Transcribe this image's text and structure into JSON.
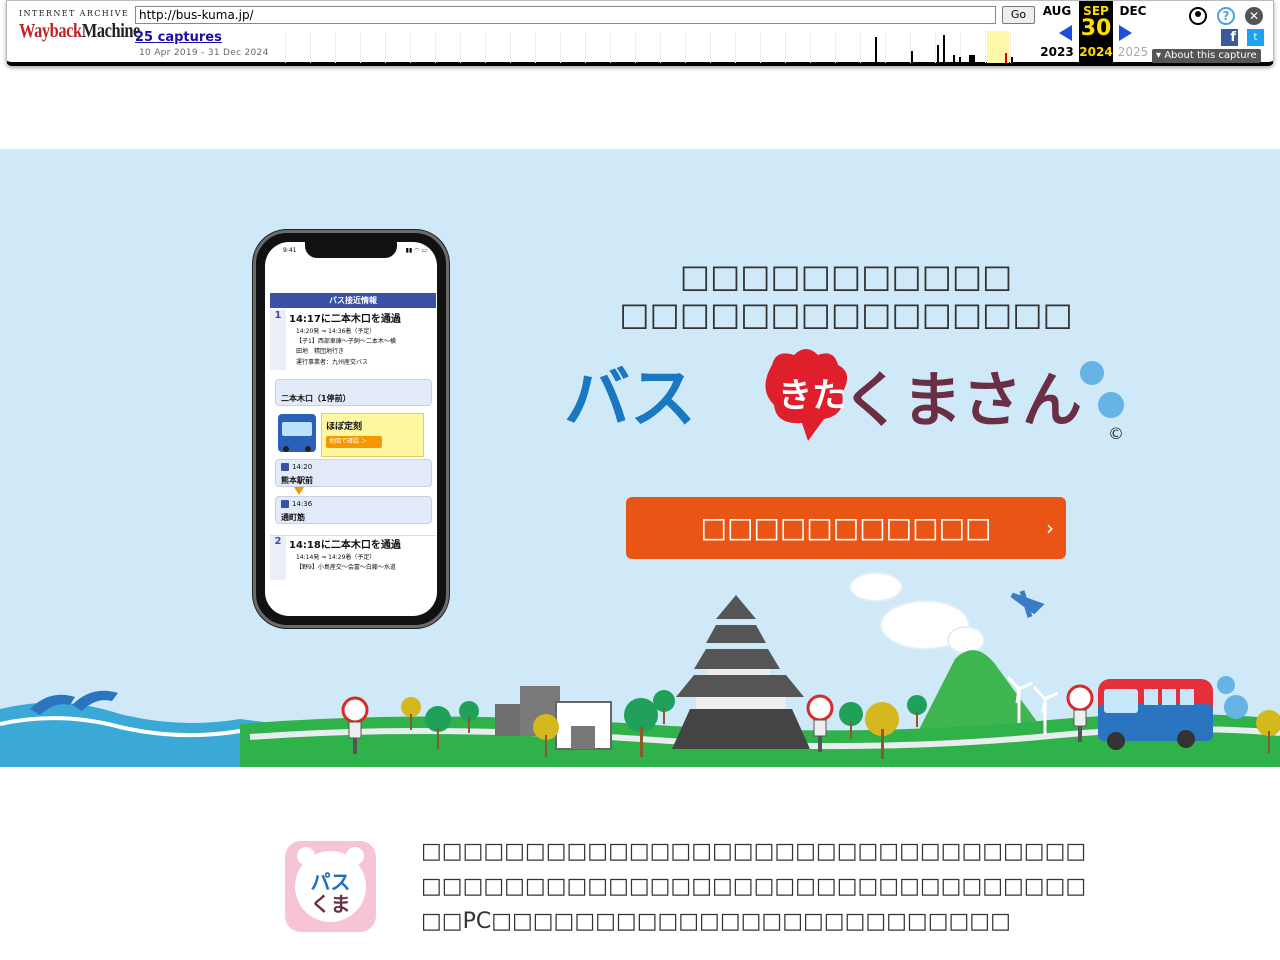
{
  "wayback": {
    "logo_top": "INTERNET ARCHIVE",
    "logo_wayback": "Wayback",
    "logo_machine": "Machine",
    "url": "http://bus-kuma.jp/",
    "go_label": "Go",
    "captures_label": "25 captures",
    "date_range": "10 Apr 2019 - 31 Dec 2024",
    "prev": {
      "month": "AUG",
      "year": "2023"
    },
    "current": {
      "month": "SEP",
      "day": "30",
      "year": "2024"
    },
    "next": {
      "month": "DEC",
      "year": "2025"
    },
    "help_glyph": "?",
    "close_glyph": "✕",
    "facebook_glyph": "f",
    "twitter_glyph": "t",
    "about_label": "▾ About this capture",
    "colors": {
      "accent": "#1a4fd8",
      "current_bg": "#000000",
      "current_fg": "#ffdd00"
    }
  },
  "phone": {
    "status_time": "9:41",
    "header": "バス接近情報",
    "entries": [
      {
        "num": "1",
        "title": "14:17に二本木口を通過",
        "line1": "14:20発 ⇒ 14:36着（予定）",
        "line2": "【子1】西部車庫〜子飼〜二本木〜横",
        "line3": "田地　精団地行き",
        "line4": "運行事業者：九州産交バス"
      },
      {
        "num": "2",
        "title": "14:18に二本木口を通過",
        "line1": "14:14発 ⇒ 14:29着（予定）",
        "line2": "【野9】小島産交〜会富〜白藤〜水道"
      }
    ],
    "stop_name": "二本木口（1停前）",
    "status_label": "ほぼ定刻",
    "map_button": "地図で確認 ＞",
    "from_time": "14:20",
    "from_stop": "熊本駅前",
    "to_time": "14:36",
    "to_stop": "通町筋"
  },
  "hero": {
    "headline_line1": "□□□□□□□□□□□",
    "headline_line2": "□□□□□□□□□□□□□□□",
    "logo_text_a": "バス",
    "logo_text_b": "きた",
    "logo_text_c": "くまさん",
    "copyright": "©",
    "cta_label": "□□□□□□□□□□□",
    "cta_arrow": "›",
    "bus_stop_label": "BUS STOP",
    "colors": {
      "sky": "#cfe9f8",
      "cta": "#e85514",
      "logo_blue": "#1a78c2",
      "logo_red": "#e01f2c"
    }
  },
  "intro": {
    "app_icon_line1": "パス",
    "app_icon_line2": "くま",
    "text_line1": "□□□□□□□□□□□□□□□□□□□□□□□□□□□□□□□□",
    "text_line2": "□□□□□□□□□□□□□□□□□□□□□□□□□□□□□□□□",
    "text_line3": "□□PC□□□□□□□□□□□□□□□□□□□□□□□□□"
  }
}
